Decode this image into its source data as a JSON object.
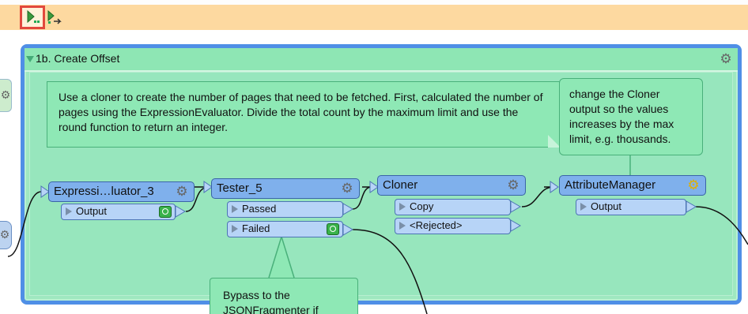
{
  "toolbar": {
    "buttons": [
      {
        "name": "run-to-this-icon"
      },
      {
        "name": "run-from-this-icon"
      }
    ]
  },
  "bookmark": {
    "title": "1b. Create Offset"
  },
  "notes": {
    "main": "Use a cloner to create the number of pages that need to be fetched. First, calculated the number of pages using the ExpressionEvaluator. Divide the total count by the maximum limit and use the round function to return an integer.",
    "cloner": "change the Cloner output so the values increases by the max limit, e.g. thousands.",
    "bypass": "Bypass to the JSONFragmenter if"
  },
  "transformers": {
    "expr": {
      "label": "Expressi…luator_3",
      "ports": [
        "Output"
      ]
    },
    "tester": {
      "label": "Tester_5",
      "ports": [
        "Passed",
        "Failed"
      ]
    },
    "cloner": {
      "label": "Cloner",
      "ports": [
        "Copy",
        "<Rejected>"
      ]
    },
    "attr": {
      "label": "AttributeManager",
      "ports": [
        "Output"
      ]
    }
  },
  "colors": {
    "bookmark_border": "#4f8fe6",
    "bookmark_fill": "#97e6bd",
    "transformer": "#7fb0ec",
    "port": "#b7d4f7",
    "inspect": "#39b24a",
    "toolbar": "#fdd9a0",
    "highlight": "#e2483d"
  }
}
